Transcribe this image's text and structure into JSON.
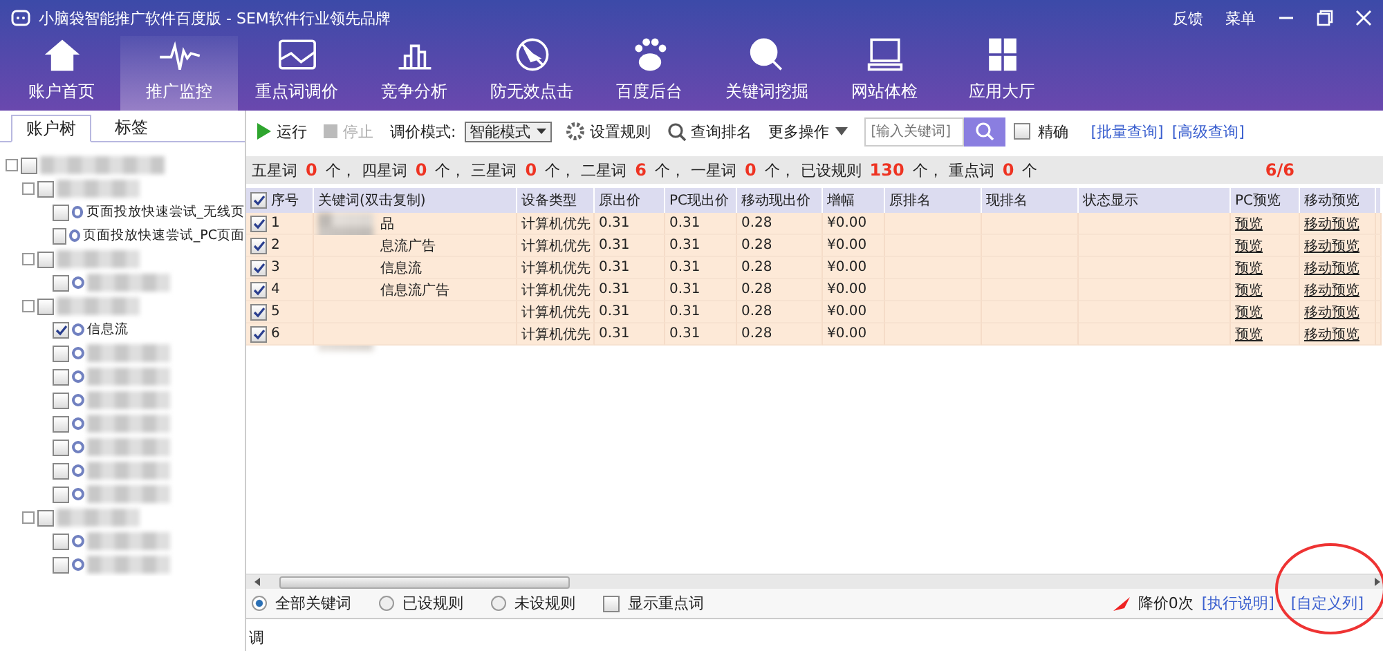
{
  "window": {
    "title": "小脑袋智能推广软件百度版 - SEM软件行业领先品牌",
    "actions": [
      "反馈",
      "菜单"
    ]
  },
  "nav": [
    {
      "label": "账户首页",
      "selected": false
    },
    {
      "label": "推广监控",
      "selected": true
    },
    {
      "label": "重点词调价",
      "selected": false
    },
    {
      "label": "竞争分析",
      "selected": false
    },
    {
      "label": "防无效点击",
      "selected": false
    },
    {
      "label": "百度后台",
      "selected": false
    },
    {
      "label": "关键词挖掘",
      "selected": false
    },
    {
      "label": "网站体检",
      "selected": false
    },
    {
      "label": "应用大厅",
      "selected": false
    }
  ],
  "sidebar": {
    "tabs": [
      {
        "label": "账户树",
        "selected": true
      },
      {
        "label": "标签",
        "selected": false
      }
    ],
    "tree": [
      {
        "checked": false,
        "children": [
          {
            "checked": false,
            "children": [
              {
                "label": "页面投放快速尝试_无线页",
                "checked": false
              },
              {
                "label": "页面投放快速尝试_PC页面",
                "checked": false
              }
            ]
          },
          {
            "checked": false,
            "children": [
              {
                "checked": false
              }
            ]
          },
          {
            "checked": false,
            "children": [
              {
                "label": "信息流",
                "checked": true
              },
              {
                "checked": false
              },
              {
                "checked": false
              },
              {
                "checked": false
              },
              {
                "checked": false
              },
              {
                "checked": false
              },
              {
                "checked": false
              },
              {
                "checked": false
              }
            ]
          },
          {
            "checked": false,
            "children": [
              {
                "checked": false
              },
              {
                "checked": false
              }
            ]
          }
        ]
      }
    ]
  },
  "toolbar": {
    "run": "运行",
    "stop": "停止",
    "mode_label": "调价模式:",
    "mode": "智能模式",
    "rules": "设置规则",
    "query_rank": "查询排名",
    "more": "更多操作",
    "search_placeholder": "[输入关键词]",
    "exact": {
      "label": "精确",
      "checked": false
    },
    "links": [
      "[批量查询]",
      "[高级查询]"
    ]
  },
  "stats": [
    {
      "label": "五星词",
      "count": "0",
      "unit": "个，"
    },
    {
      "label": "四星词",
      "count": "0",
      "unit": "个，"
    },
    {
      "label": "三星词",
      "count": "0",
      "unit": "个，"
    },
    {
      "label": "二星词",
      "count": "6",
      "unit": "个，"
    },
    {
      "label": "一星词",
      "count": "0",
      "unit": "个，"
    },
    {
      "label": "已设规则",
      "count": "130",
      "unit": "个，"
    },
    {
      "label": "重点词",
      "count": "0",
      "unit": "个"
    }
  ],
  "page_count": "6/6",
  "table": {
    "all_checked": true,
    "columns": [
      "序号",
      "关键词(双击复制)",
      "设备类型",
      "原出价",
      "PC现出价",
      "移动现出价",
      "增幅",
      "原排名",
      "现排名",
      "状态显示",
      "PC预览",
      "移动预览"
    ],
    "rows": [
      {
        "checked": true,
        "cells": [
          "1",
          "品",
          "计算机优先",
          "0.31",
          "0.31",
          "0.28",
          "¥0.00",
          "",
          "",
          "",
          "预览",
          "移动预览"
        ]
      },
      {
        "checked": true,
        "cells": [
          "2",
          "息流广告",
          "计算机优先",
          "0.31",
          "0.31",
          "0.28",
          "¥0.00",
          "",
          "",
          "",
          "预览",
          "移动预览"
        ]
      },
      {
        "checked": true,
        "cells": [
          "3",
          "信息流",
          "计算机优先",
          "0.31",
          "0.31",
          "0.28",
          "¥0.00",
          "",
          "",
          "",
          "预览",
          "移动预览"
        ]
      },
      {
        "checked": true,
        "cells": [
          "4",
          "信息流广告",
          "计算机优先",
          "0.31",
          "0.31",
          "0.28",
          "¥0.00",
          "",
          "",
          "",
          "预览",
          "移动预览"
        ]
      },
      {
        "checked": true,
        "cells": [
          "5",
          "",
          "计算机优先",
          "0.31",
          "0.31",
          "0.28",
          "¥0.00",
          "",
          "",
          "",
          "预览",
          "移动预览"
        ]
      },
      {
        "checked": true,
        "cells": [
          "6",
          "",
          "计算机优先",
          "0.31",
          "0.31",
          "0.28",
          "¥0.00",
          "",
          "",
          "",
          "预览",
          "移动预览"
        ]
      }
    ]
  },
  "filters": [
    {
      "label": "全部关键词",
      "kind": "radio",
      "selected": true
    },
    {
      "label": "已设规则",
      "kind": "radio",
      "selected": false
    },
    {
      "label": "未设规则",
      "kind": "radio",
      "selected": false
    },
    {
      "label": "显示重点词",
      "kind": "checkbox",
      "selected": false
    }
  ],
  "footer": {
    "status": "降价0次",
    "links": [
      "[执行说明]",
      "[自定义列]"
    ]
  },
  "log_label": "调"
}
